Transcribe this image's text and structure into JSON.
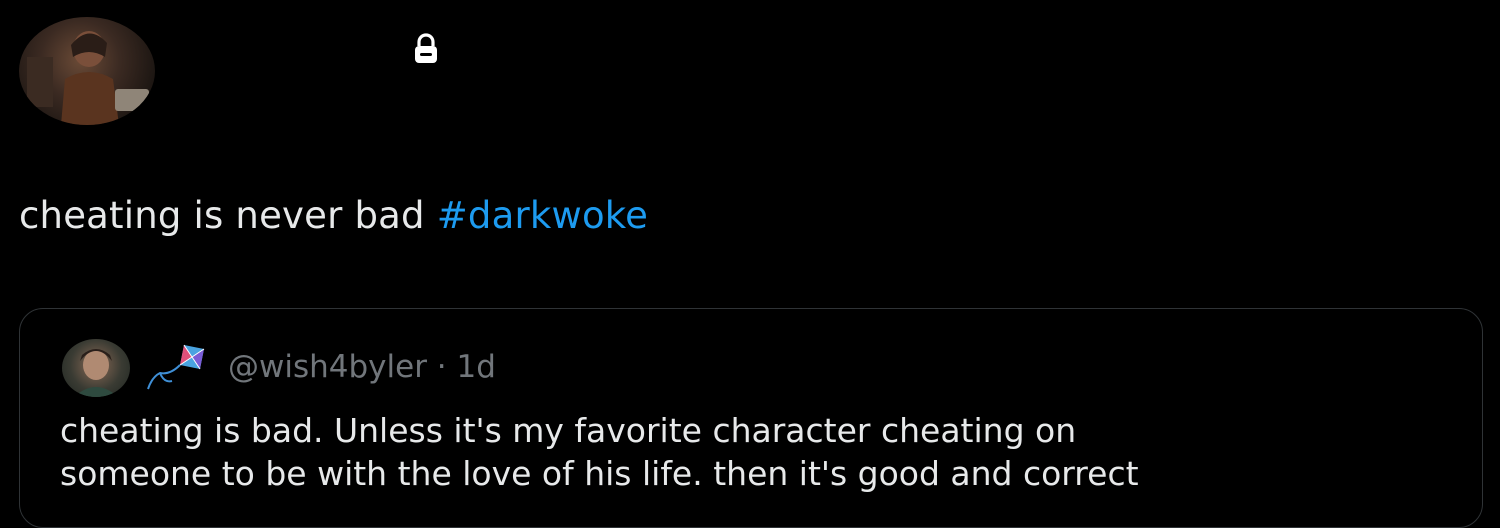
{
  "post": {
    "avatar_icon": "profile-photo-icon",
    "lock_icon": "lock-icon",
    "text_plain": "cheating is never bad ",
    "hashtag": "#darkwoke",
    "colors": {
      "background": "#000000",
      "text": "#e7e9ea",
      "link": "#1d9bf0",
      "muted": "#71767b",
      "border": "#2f3336"
    }
  },
  "quote": {
    "avatar_icon": "quoted-user-avatar-icon",
    "kite_icon": "kite-emoji-icon",
    "handle": "@wish4byler · 1d",
    "lines": [
      "cheating is bad. Unless it's my favorite character cheating on",
      "someone to be with the love of his life. then it's good and correct"
    ]
  }
}
